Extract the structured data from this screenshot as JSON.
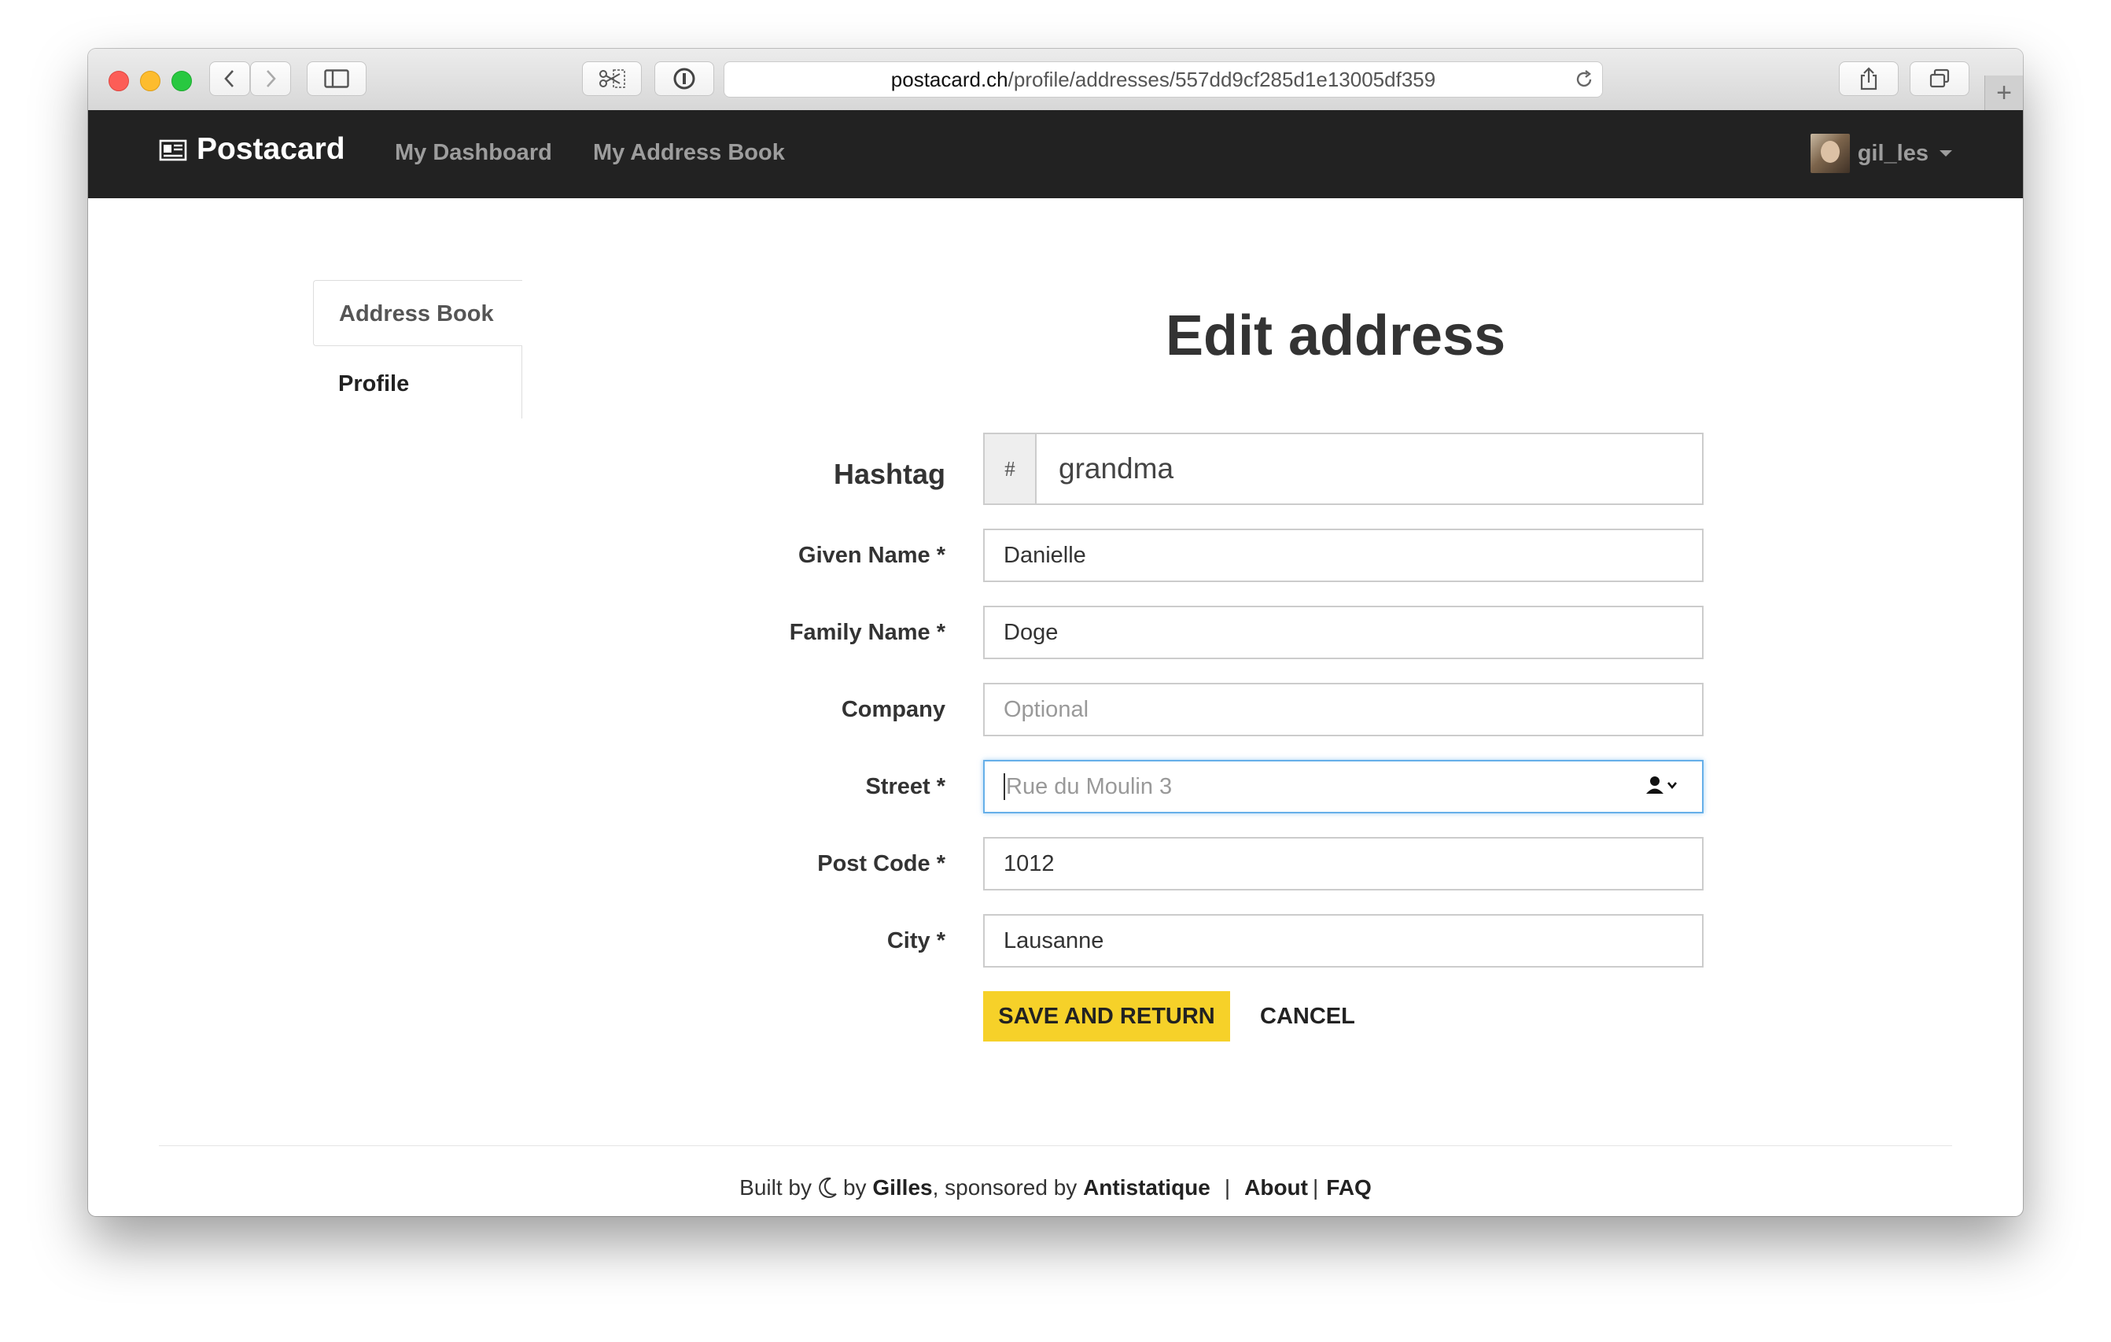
{
  "browser": {
    "url_host": "postacard.ch",
    "url_path": "/profile/addresses/557dd9cf285d1e13005df359",
    "new_tab_symbol": "+"
  },
  "navbar": {
    "brand": "Postacard",
    "links": [
      "My Dashboard",
      "My Address Book"
    ],
    "username": "gil_les"
  },
  "sidebar": {
    "items": [
      {
        "label": "Address Book",
        "active": true
      },
      {
        "label": "Profile",
        "active": false
      }
    ]
  },
  "main": {
    "title": "Edit address",
    "hashtag": {
      "label": "Hashtag",
      "prefix": "#",
      "value": "grandma"
    },
    "fields": {
      "given_name": {
        "label": "Given Name *",
        "value": "Danielle"
      },
      "family_name": {
        "label": "Family Name *",
        "value": "Doge"
      },
      "company": {
        "label": "Company",
        "placeholder": "Optional"
      },
      "street": {
        "label": "Street *",
        "placeholder": "Rue du Moulin 3"
      },
      "post_code": {
        "label": "Post Code *",
        "value": "1012"
      },
      "city": {
        "label": "City *",
        "value": "Lausanne"
      }
    },
    "buttons": {
      "save": "SAVE AND RETURN",
      "cancel": "CANCEL"
    }
  },
  "footer": {
    "built_by": "Built by",
    "by": "by",
    "author": "Gilles",
    "sponsored_by": ", sponsored by",
    "sponsor": "Antistatique",
    "separator": "|",
    "about": "About",
    "faq": "FAQ"
  },
  "colors": {
    "navbar_bg": "#222222",
    "primary_button": "#f6d129",
    "focus_border": "#66afe9"
  }
}
